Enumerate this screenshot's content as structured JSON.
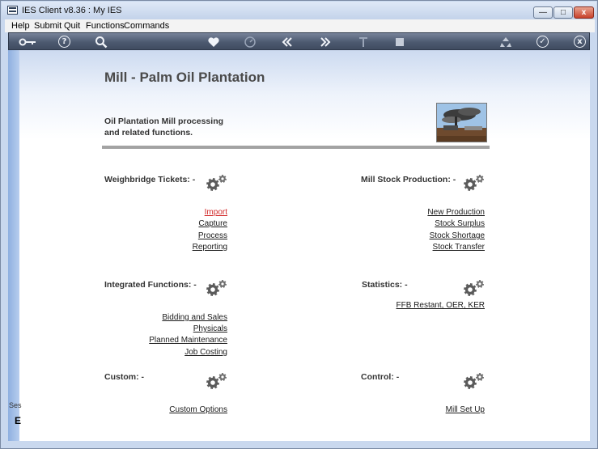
{
  "window": {
    "title": "IES Client v8.36 : My IES",
    "min_label": "—",
    "max_label": "□",
    "close_label": "x"
  },
  "menu": [
    "Help",
    "Submit",
    "Quit",
    "Functions",
    "Commands"
  ],
  "toolbar": {
    "icons": [
      "key-icon",
      "help-icon",
      "search-icon",
      "favorite-icon",
      "clock-icon",
      "back-icon",
      "forward-icon",
      "text-icon",
      "stop-icon",
      "recycle-icon",
      "confirm-icon",
      "close-icon"
    ],
    "help_glyph": "?",
    "confirm_glyph": "✓",
    "close_glyph": "x"
  },
  "page": {
    "title": "Mill - Palm Oil Plantation",
    "subtitle_line1": "Oil Plantation Mill processing",
    "subtitle_line2": "and related functions."
  },
  "sections": {
    "weighbridge": {
      "label": "Weighbridge Tickets: -",
      "links": [
        "Import",
        "Capture",
        "Process",
        "Reporting"
      ]
    },
    "mill_stock": {
      "label": "Mill Stock Production: -",
      "links": [
        "New Production",
        "Stock Surplus",
        "Stock Shortage",
        "Stock Transfer"
      ]
    },
    "integrated": {
      "label": "Integrated Functions: -",
      "links": [
        "Bidding and Sales",
        "Physicals",
        "Planned Maintenance",
        "Job Costing"
      ]
    },
    "statistics": {
      "label": "Statistics: -",
      "links": [
        "FFB Restant, OER, KER"
      ]
    },
    "custom": {
      "label": "Custom: -",
      "links": [
        "Custom Options"
      ]
    },
    "control": {
      "label": "Control: -",
      "links": [
        "Mill Set Up"
      ]
    }
  },
  "side": {
    "label": "Ses",
    "glyph": "E"
  },
  "colors": {
    "active_link": "#d22a2a",
    "toolbar": "#4d5a70",
    "title_text": "#4a4a4a"
  }
}
